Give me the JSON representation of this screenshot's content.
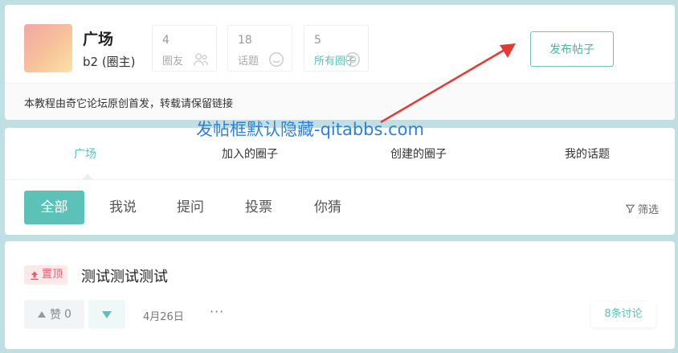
{
  "circle": {
    "title": "广场",
    "owner": "b2 (圈主)"
  },
  "stats": [
    {
      "num": "4",
      "label": "圈友",
      "icon": "users-icon"
    },
    {
      "num": "18",
      "label": "话题",
      "icon": "chat-icon"
    },
    {
      "num": "5",
      "label": "所有圈子",
      "icon": "circles-icon"
    }
  ],
  "actions": {
    "publish_label": "发布帖子"
  },
  "notice": "本教程由奇它论坛原创首发，转载请保留链接",
  "watermark": "发帖框默认隐藏-qitabbs.com",
  "main_tabs": [
    "广场",
    "加入的圈子",
    "创建的圈子",
    "我的话题"
  ],
  "sub_tabs": [
    "全部",
    "我说",
    "提问",
    "投票",
    "你猜"
  ],
  "filter_label": "筛选",
  "post": {
    "badge": "置顶",
    "title": "测试测试测试",
    "like_label": "赞",
    "like_count": "0",
    "date": "4月26日",
    "more": "···",
    "discuss": "8条讨论"
  },
  "colors": {
    "accent": "#5cc2b8",
    "pin": "#e8596a",
    "watermark": "#2f7fe0",
    "arrow": "#e53935"
  }
}
